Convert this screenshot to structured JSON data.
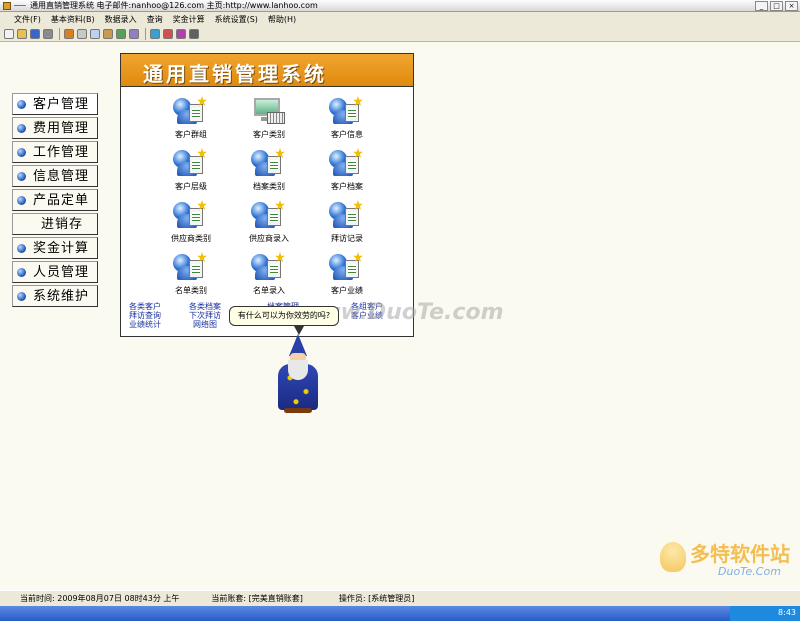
{
  "window": {
    "title": "通用直销管理系统  电子邮件:nanhoo@126.com 主页:http://www.lanhoo.com"
  },
  "menu": [
    "文件(F)",
    "基本资料(B)",
    "数据录入",
    "查询",
    "奖金计算",
    "系统设置(S)",
    "帮助(H)"
  ],
  "toolbar": {
    "icons": [
      {
        "name": "new-icon",
        "color": "#f2f2f2"
      },
      {
        "name": "open-icon",
        "color": "#e8c050"
      },
      {
        "name": "save-icon",
        "color": "#3b66c8"
      },
      {
        "name": "print-icon",
        "color": "#8a8a8a"
      },
      {
        "name": "edit-icon",
        "color": "#d87f20"
      },
      {
        "name": "cut-icon",
        "color": "#c8c8c8"
      },
      {
        "name": "copy-icon",
        "color": "#bcd0f0"
      },
      {
        "name": "paste-icon",
        "color": "#c89a50"
      },
      {
        "name": "find-icon",
        "color": "#58a058"
      },
      {
        "name": "calc-icon",
        "color": "#9080c0"
      },
      {
        "name": "globe-icon",
        "color": "#3aa0d0"
      },
      {
        "name": "user-icon",
        "color": "#d05050"
      },
      {
        "name": "help-icon",
        "color": "#b040b0"
      },
      {
        "name": "exit-icon",
        "color": "#606060"
      }
    ]
  },
  "nav": [
    {
      "label": "客户管理"
    },
    {
      "label": "费用管理"
    },
    {
      "label": "工作管理"
    },
    {
      "label": "信息管理"
    },
    {
      "label": "产品定单"
    },
    {
      "label": "进销存"
    },
    {
      "label": "奖金计算"
    },
    {
      "label": "人员管理"
    },
    {
      "label": "系统维护"
    }
  ],
  "panel": {
    "title": "通用直销管理系统",
    "items": [
      {
        "label": "客户群组",
        "icon": "people-doc-icon"
      },
      {
        "label": "客户类别",
        "icon": "computer-icon"
      },
      {
        "label": "客户信息",
        "icon": "people-doc-icon"
      },
      {
        "label": "客户层级",
        "icon": "people-doc-icon"
      },
      {
        "label": "档案类别",
        "icon": "people-doc-icon"
      },
      {
        "label": "客户档案",
        "icon": "people-doc-icon"
      },
      {
        "label": "供应商类别",
        "icon": "people-doc-icon"
      },
      {
        "label": "供应商录入",
        "icon": "people-doc-icon"
      },
      {
        "label": "拜访记录",
        "icon": "people-doc-icon"
      },
      {
        "label": "名单类别",
        "icon": "people-doc-icon"
      },
      {
        "label": "名单录入",
        "icon": "people-doc-icon"
      },
      {
        "label": "客户业绩",
        "icon": "people-doc-icon"
      }
    ],
    "links": {
      "row1": [
        "各类客户",
        "各类档案",
        "档案管理",
        "各组客户"
      ],
      "row2": [
        "拜访查询",
        "下次拜访",
        "",
        "客户业绩"
      ],
      "row3": [
        "业绩统计",
        "网络图"
      ]
    }
  },
  "assistant": {
    "bubble": "有什么可以为你效劳的吗?"
  },
  "watermark": {
    "center": "www.DuoTe.com",
    "corner_big": "多特软件站",
    "corner_sub": "DuoTe.Com"
  },
  "status": {
    "time": "当前时间: 2009年08月07日 08时43分 上午",
    "account": "当前账套: [完美直销账套]",
    "operator": "操作员: [系统管理员]"
  },
  "taskbar": {
    "clock": "8:43"
  }
}
